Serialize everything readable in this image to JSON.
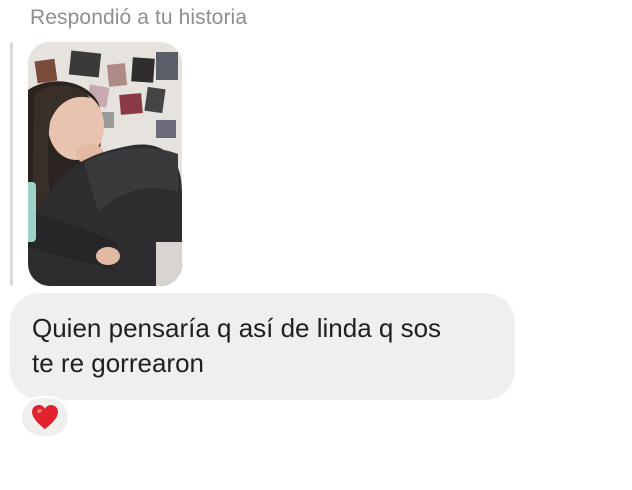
{
  "header": {
    "reply_label": "Respondió a tu historia"
  },
  "story": {
    "thumbnail": "story-photo"
  },
  "message": {
    "text": "Quien pensaría q así de linda q sos\nte re gorrearon"
  },
  "reaction": {
    "emoji": "heart-icon",
    "color": "#e0232e"
  }
}
